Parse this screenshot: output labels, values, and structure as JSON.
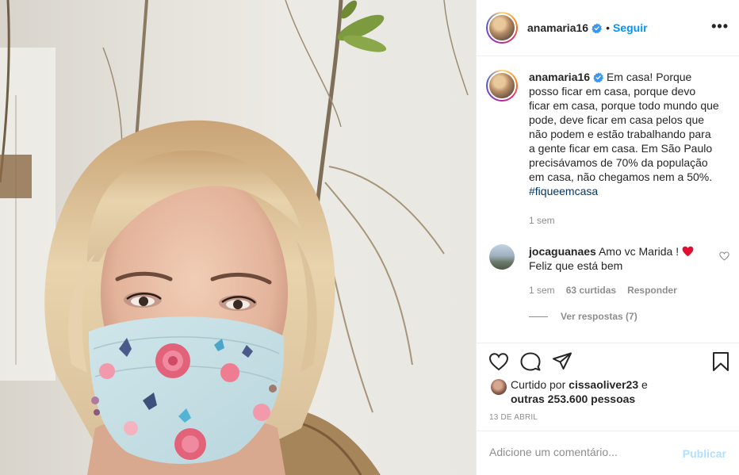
{
  "post": {
    "username": "anamaria16",
    "follow_label": "Seguir",
    "separator": "•",
    "more_label": "•••"
  },
  "caption": {
    "username": "anamaria16",
    "text": " Em casa! Porque posso ficar em casa, porque devo ficar em casa, porque todo mundo que pode, deve ficar em casa pelos que não podem e estão trabalhando para a gente ficar em casa. Em São Paulo precisávamos de 70% da população em casa, não chegamos nem a 50%. ",
    "hashtag": "#fiqueemcasa",
    "time": "1 sem"
  },
  "comment": {
    "username": "jocaguanaes",
    "text": " Amo vc Marida ! ",
    "text_line2": "Feliz que está bem",
    "time": "1 sem",
    "likes": "63 curtidas",
    "reply_label": "Responder",
    "view_replies": "Ver respostas (7)"
  },
  "likes": {
    "prefix": "Curtido por ",
    "user": "cissaoliver23",
    "middle": " e",
    "others": "outras 253.600 pessoas"
  },
  "date": "13 DE ABRIL",
  "add_comment": {
    "placeholder": "Adicione um comentário...",
    "publish_label": "Publicar"
  },
  "icons": {
    "verified": "verified-badge-icon",
    "like": "heart-icon",
    "comment": "comment-icon",
    "share": "paper-plane-icon",
    "save": "bookmark-icon"
  },
  "colors": {
    "accent": "#0095f6",
    "hashtag": "#00376b",
    "muted": "#8e8e8e",
    "heart_red": "#ed4956",
    "publish_disabled": "#b2dffc"
  }
}
